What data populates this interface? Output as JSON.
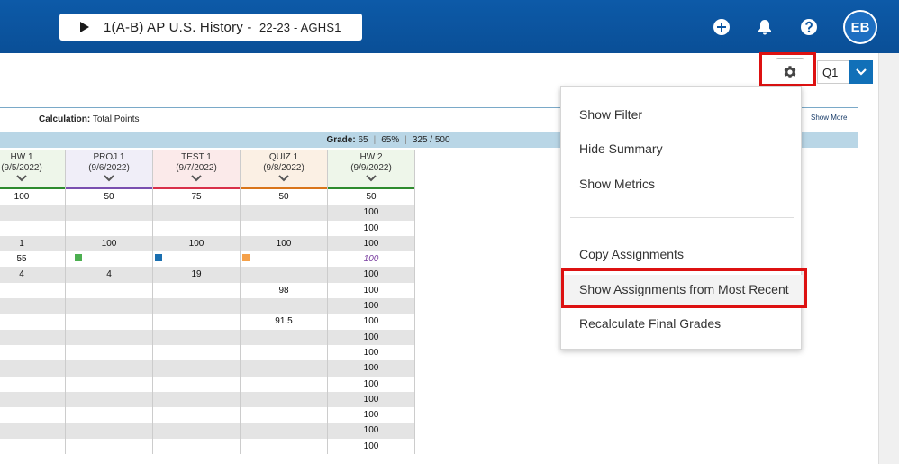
{
  "header": {
    "course_title": "1(A-B) AP U.S. History - ",
    "course_sub": "22-23 - AGHS1",
    "avatar_initials": "EB",
    "colors": {
      "bar": "#0b55a2",
      "accent": "#1170b8"
    }
  },
  "toolbar": {
    "quarter": "Q1"
  },
  "summary": {
    "calc_label": "Calculation:",
    "calc_value": "Total Points",
    "show_more": "Show More",
    "grade_label": "Grade:",
    "grade_value": "65",
    "percent": "65%",
    "points": "325 / 500"
  },
  "columns": [
    {
      "name": "HW 1",
      "date": "(9/5/2022)",
      "color": "#2e8b2e",
      "bg": "#eef6ea",
      "cells": [
        "100",
        "",
        "",
        "1",
        "55",
        "4",
        "",
        "",
        "",
        "",
        "",
        "",
        "",
        "",
        "",
        "",
        ""
      ]
    },
    {
      "name": "PROJ 1",
      "date": "(9/6/2022)",
      "color": "#7a4fb0",
      "bg": "#f0eef8",
      "cells": [
        "50",
        "",
        "",
        "100",
        "",
        "4",
        "",
        "",
        "",
        "",
        "",
        "",
        "",
        "",
        "",
        "",
        ""
      ]
    },
    {
      "name": "TEST 1",
      "date": "(9/7/2022)",
      "color": "#d9304a",
      "bg": "#fbeaea",
      "cells": [
        "75",
        "",
        "",
        "100",
        "",
        "19",
        "",
        "",
        "",
        "",
        "",
        "",
        "",
        "",
        "",
        "",
        ""
      ]
    },
    {
      "name": "QUIZ 1",
      "date": "(9/8/2022)",
      "color": "#d9751a",
      "bg": "#fbf0e4",
      "cells": [
        "50",
        "",
        "",
        "100",
        "",
        "",
        "98",
        "",
        "91.5",
        "",
        "",
        "",
        "",
        "",
        "",
        "",
        ""
      ]
    },
    {
      "name": "HW 2",
      "date": "(9/9/2022)",
      "color": "#2e8b2e",
      "bg": "#eef6ea",
      "cells": [
        "50",
        "100",
        "100",
        "100",
        "100",
        "100",
        "100",
        "100",
        "100",
        "100",
        "100",
        "100",
        "100",
        "100",
        "100",
        "100",
        "100"
      ]
    }
  ],
  "flags": {
    "green": "#4caf50",
    "blue": "#1a6fb0",
    "orange": "#f5a14a"
  },
  "menu": {
    "items": [
      "Show Filter",
      "Hide Summary",
      "Show Metrics",
      "Copy Assignments",
      "Show Assignments from Most Recent",
      "Recalculate Final Grades"
    ]
  }
}
